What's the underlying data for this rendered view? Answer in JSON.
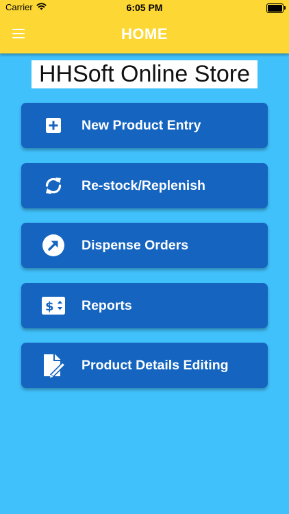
{
  "status_bar": {
    "carrier": "Carrier",
    "time": "6:05 PM"
  },
  "header": {
    "title": "HOME",
    "background_color": "#fdd835"
  },
  "store": {
    "title": "HHSoft Online Store"
  },
  "menu": {
    "items": [
      {
        "label": "New Product Entry",
        "icon": "plus-square-icon"
      },
      {
        "label": "Re-stock/Replenish",
        "icon": "sync-icon"
      },
      {
        "label": "Dispense Orders",
        "icon": "arrow-up-right-circle-icon"
      },
      {
        "label": "Reports",
        "icon": "dollar-sort-icon"
      },
      {
        "label": "Product Details Editing",
        "icon": "file-edit-icon"
      }
    ],
    "button_color": "#1565c0"
  },
  "colors": {
    "background": "#41c1fb",
    "accent": "#fdd835"
  }
}
